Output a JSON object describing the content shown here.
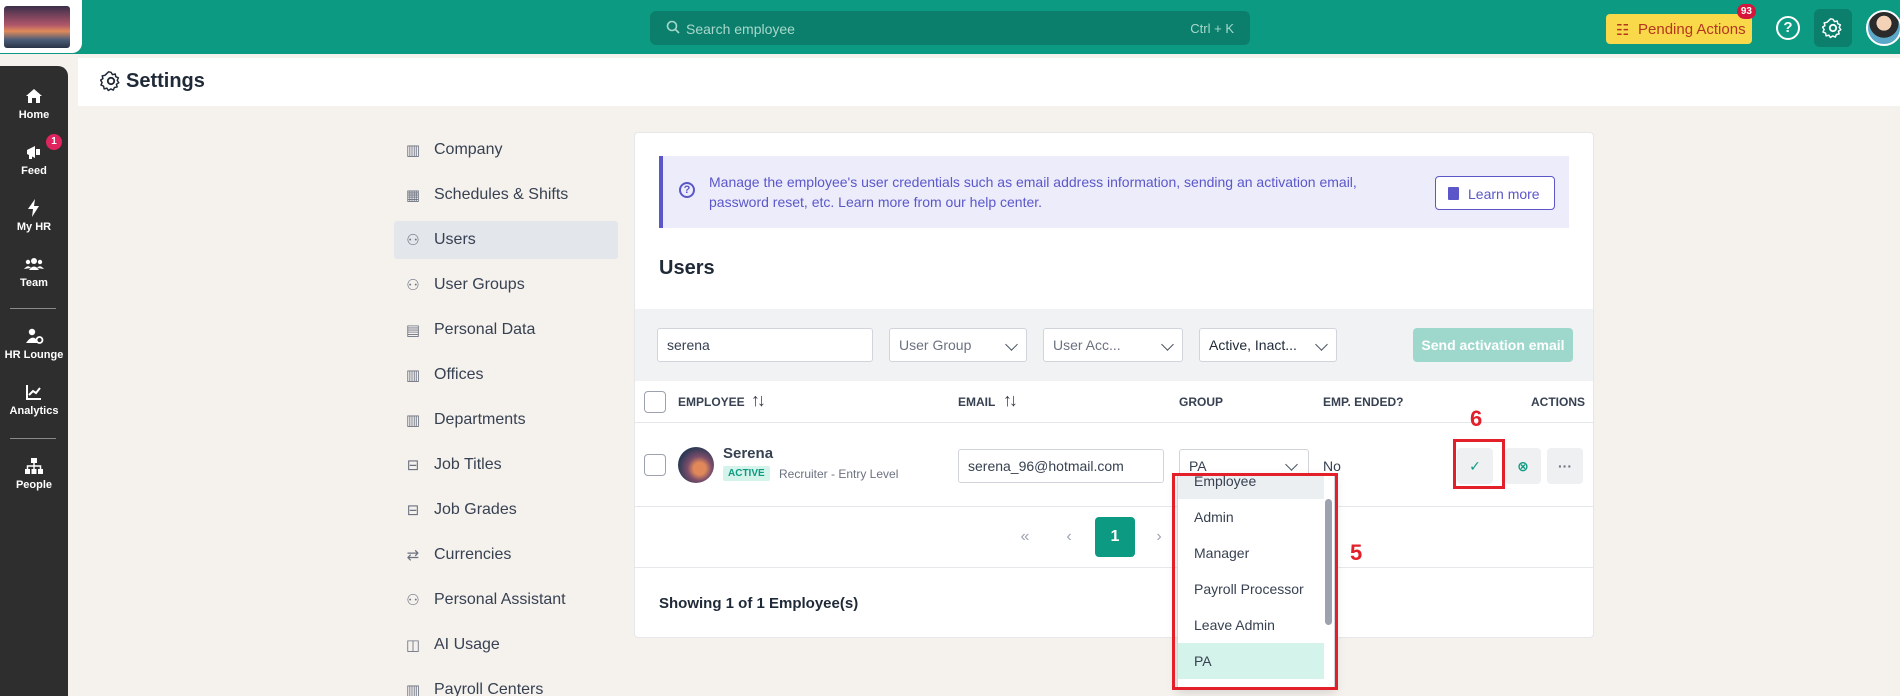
{
  "topbar": {
    "search_placeholder": "Search employee",
    "search_shortcut": "Ctrl + K",
    "pending_label": "Pending Actions",
    "pending_count": "93",
    "help_glyph": "?",
    "accent_color": "#0d9a82"
  },
  "rail": {
    "items": [
      {
        "label": "Home",
        "icon": "home-icon"
      },
      {
        "label": "Feed",
        "icon": "megaphone-icon",
        "badge": "1"
      },
      {
        "label": "My HR",
        "icon": "bolt-icon"
      },
      {
        "label": "Team",
        "icon": "team-icon"
      },
      {
        "label": "HR Lounge",
        "icon": "user-gear-icon"
      },
      {
        "label": "Analytics",
        "icon": "chart-icon"
      },
      {
        "label": "People",
        "icon": "org-chart-icon"
      }
    ]
  },
  "settings": {
    "title": "Settings",
    "nav": [
      {
        "label": "Company"
      },
      {
        "label": "Schedules & Shifts"
      },
      {
        "label": "Users",
        "active": true
      },
      {
        "label": "User Groups"
      },
      {
        "label": "Personal Data"
      },
      {
        "label": "Offices"
      },
      {
        "label": "Departments"
      },
      {
        "label": "Job Titles"
      },
      {
        "label": "Job Grades"
      },
      {
        "label": "Currencies"
      },
      {
        "label": "Personal Assistant"
      },
      {
        "label": "AI Usage"
      },
      {
        "label": "Payroll Centers"
      }
    ]
  },
  "users": {
    "info_text": "Manage the employee's user credentials such as email address information, sending an activation email, password reset, etc. Learn more from our help center.",
    "learn_more": "Learn more",
    "title": "Users",
    "filters": {
      "search_value": "serena",
      "user_group": "User Group",
      "user_access": "User Acc...",
      "status": "Active, Inact..."
    },
    "send_activation": "Send activation email",
    "columns": {
      "employee": "EMPLOYEE",
      "email": "EMAIL",
      "group": "GROUP",
      "emp_ended": "EMP. ENDED?",
      "actions": "ACTIONS"
    },
    "row": {
      "name": "Serena",
      "status": "ACTIVE",
      "role": "Recruiter - Entry Level",
      "email": "serena_96@hotmail.com",
      "group": "PA",
      "ended": "No"
    },
    "pagination": {
      "first": "«",
      "prev": "‹",
      "current": "1",
      "next": "›"
    },
    "showing": "Showing 1 of 1 Employee(s)"
  },
  "dropdown": {
    "options": [
      "Employee",
      "Admin",
      "Manager",
      "Payroll Processor",
      "Leave Admin",
      "PA"
    ],
    "selected": "PA"
  },
  "annotations": {
    "label_5": "5",
    "label_6": "6",
    "color": "#e3202a"
  }
}
